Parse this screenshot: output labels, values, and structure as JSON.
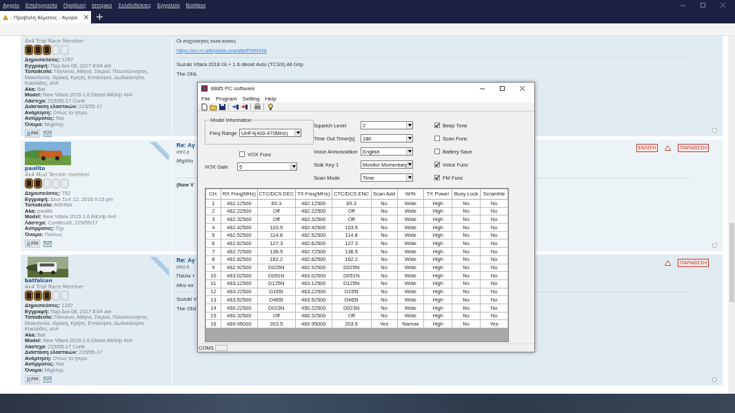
{
  "browser": {
    "menu": [
      "Αρχείο",
      "Επεξεργασία",
      "Προβολή",
      "Ιστορικό",
      "Σελιδοδείκτες",
      "Εργαλεία",
      "Βοήθεια"
    ],
    "tab": {
      "title": "- Προβολή θέματος - Αγορα",
      "selected": true
    }
  },
  "posts": [
    {
      "rank": "4x4 Trial Race Member",
      "stars": 3,
      "stats": [
        "**Δημοσιεύσεις:** 1257",
        "**Εγγραφή:** Παρ Δεκ 08, 2017 8:04 am",
        "**Τοποθεσία:** Γιάννενα, Αθήνα, Στερεά, Πελοπόννησος, Μακεδονία, Θράκη, Κρήτη, Επτάνησα, Δωδεκάνησα, Κυκλάδες, κλπ",
        "**Aka:** Bat",
        "**Model:** New Vitara 2015 1.6 Diesel AllGrip 4x4",
        "**Λάστιχα:** 215/55-17 Conti",
        "**Διάσταση ελαστικών:** 215/55-17",
        "**Ανάρτηση:** Οπως το ηπρο.",
        "**Ασύρματος:** Ναι",
        "**Όνομα:** Μιχάλης"
      ],
      "pm": "PM",
      "lines": [
        {
          "kind": "text",
          "text": "Οι συχνοτητες ειναι κοινες"
        },
        {
          "kind": "link",
          "text": "https://en.m.wikipedia.org/wiki/PMR446"
        },
        {
          "kind": "rule"
        },
        {
          "kind": "text",
          "text": "Suzuki Vitara 2018 GL+ 1.6 diesel Auto (TCSS) All Grip."
        },
        {
          "kind": "text",
          "text": "The ONL"
        }
      ]
    },
    {
      "author": "paolito",
      "online": true,
      "rank": "4x4 Mud Terrain member",
      "stars": 2,
      "stats": [
        "**Δημοσιεύσεις:** 752",
        "**Εγγραφή:** Δευτ Σεπ 12, 2016 9:15 pm",
        "**Τοποθεσία:** ΑΘΗΝΑ",
        "**Aka:** paolito",
        "**Model:** New Vitara 2015 1.6 AllGrip 4x4",
        "**Λάστιχα:** ContiEco5. 215/55/17",
        "**Ασύρματος:** Όχι",
        "**Όνομα:** Παύλος"
      ],
      "pm": "PM",
      "title": "Re: Αγ",
      "byline": "από p",
      "lines": [
        {
          "kind": "italic",
          "text": "Μιχάλη"
        },
        {
          "kind": "gap"
        },
        {
          "kind": "rule"
        },
        {
          "kind": "bold",
          "text": "(New V"
        }
      ],
      "actions": [
        {
          "kind": "button",
          "text": "ΕΚΛΙΣΗ"
        },
        {
          "kind": "warning"
        },
        {
          "kind": "button",
          "text": "ΠΑΡΑΘΕΣΗ"
        }
      ]
    },
    {
      "author": "batfalcon",
      "online": true,
      "rank": "4x4 Trial Race Member",
      "stars": 3,
      "stats": [
        "**Δημοσιεύσεις:** 1257",
        "**Εγγραφή:** Παρ Δεκ 08, 2017 8:04 am",
        "**Τοποθεσία:** Γιάννενα, Αθήνα, Στερεά, Πελοπόννησος, Μακεδονία, Θράκη, Κρήτη, Επτάνησα, Δωδεκάνησα, Κυκλάδες, κλπ",
        "**Aka:** Bat",
        "**Model:** New Vitara 2015 1.6 Diesel AllGrip 4x4",
        "**Λάστιχα:** 215/55-17 Conti",
        "**Διάσταση ελαστικών:** 215/55-17",
        "**Ανάρτηση:** Οπως το ηπρο.",
        "**Ασύρματος:** Ναι",
        "**Όνομα:** Μιχάλης"
      ],
      "pm": "PM",
      "title": "Re: Αγ",
      "byline": "από b",
      "lines": [
        {
          "kind": "text",
          "text": "Παυλε τ"
        },
        {
          "kind": "italic",
          "text": "Μου κα"
        },
        {
          "kind": "rule"
        },
        {
          "kind": "text",
          "text": "Suzuki V"
        },
        {
          "kind": "text",
          "text": "The ONI"
        }
      ],
      "actions": [
        {
          "kind": "warning"
        },
        {
          "kind": "button",
          "text": "ΠΑΡΑΘΕΣΗ"
        }
      ]
    }
  ],
  "dialog": {
    "title": "8885 PC software",
    "menu": [
      "File",
      "Program",
      "Setting",
      "Help"
    ],
    "toolbar": [
      {
        "kind": "new"
      },
      {
        "kind": "open"
      },
      {
        "kind": "save"
      },
      {
        "kind": "read"
      },
      {
        "kind": "write"
      },
      {
        "kind": "print"
      },
      {
        "kind": "help"
      }
    ],
    "model_information": {
      "legend": "Model Information",
      "label": "Freq Range",
      "value": "UHF4(400-470MHz)"
    },
    "vox_func": {
      "label": "VOX Func",
      "checked": false
    },
    "vox_gain": {
      "label": "VOX Gain",
      "value": "5"
    },
    "selects": [
      {
        "label": "Squelch Level",
        "value": "2"
      },
      {
        "label": "Time Out Timer[s]",
        "value": "180"
      },
      {
        "label": "Voice Annunciation",
        "value": "English"
      },
      {
        "label": "Side Key 1",
        "value": "Monitor Momentary"
      },
      {
        "label": "Scan Mode",
        "value": "Time"
      }
    ],
    "checkboxes": [
      {
        "label": "Beep Tone",
        "checked": true
      },
      {
        "label": "Scan Func",
        "checked": false
      },
      {
        "label": "Battery Save",
        "checked": false
      },
      {
        "label": "Voice Func",
        "checked": true
      },
      {
        "label": "FM Func",
        "checked": true
      }
    ],
    "table": {
      "columns": [
        "CH.",
        "RX Freq(MHz)",
        "CTC/DCS DEC",
        "TX Freq(MHz)",
        "CTC/DCS ENC",
        "Scan Add",
        "W/N",
        "TX Power",
        "Busy Lock",
        "Scramble"
      ],
      "rows": [
        [
          "1",
          "462.12500",
          "69.3",
          "462.12500",
          "69.3",
          "No",
          "Wide",
          "High",
          "No",
          "No"
        ],
        [
          "2",
          "462.22500",
          "Off",
          "462.22500",
          "Off",
          "No",
          "Wide",
          "High",
          "No",
          "No"
        ],
        [
          "3",
          "462.32500",
          "Off",
          "462.32500",
          "Off",
          "No",
          "Wide",
          "High",
          "No",
          "No"
        ],
        [
          "4",
          "462.42500",
          "103.5",
          "462.42500",
          "103.5",
          "No",
          "Wide",
          "High",
          "No",
          "No"
        ],
        [
          "5",
          "462.52500",
          "114.8",
          "462.52500",
          "114.8",
          "No",
          "Wide",
          "High",
          "No",
          "No"
        ],
        [
          "6",
          "462.62500",
          "127.3",
          "462.62500",
          "127.3",
          "No",
          "Wide",
          "High",
          "No",
          "No"
        ],
        [
          "7",
          "462.72500",
          "136.5",
          "462.72500",
          "136.5",
          "No",
          "Wide",
          "High",
          "No",
          "No"
        ],
        [
          "8",
          "462.82500",
          "162.2",
          "462.82500",
          "162.2",
          "No",
          "Wide",
          "High",
          "No",
          "No"
        ],
        [
          "9",
          "462.92500",
          "D025N",
          "462.92500",
          "D025N",
          "No",
          "Wide",
          "High",
          "No",
          "No"
        ],
        [
          "10",
          "463.02500",
          "D051N",
          "463.02500",
          "D051N",
          "No",
          "Wide",
          "High",
          "No",
          "No"
        ],
        [
          "11",
          "463.12500",
          "D125N",
          "463.12500",
          "D125N",
          "No",
          "Wide",
          "High",
          "No",
          "No"
        ],
        [
          "12",
          "463.22500",
          "D155I",
          "463.22500",
          "D155I",
          "No",
          "Wide",
          "High",
          "No",
          "No"
        ],
        [
          "13",
          "463.52500",
          "D465I",
          "463.52500",
          "D465I",
          "No",
          "Wide",
          "High",
          "No",
          "No"
        ],
        [
          "14",
          "450.22500",
          "D023N",
          "450.22500",
          "D023N",
          "No",
          "Wide",
          "High",
          "No",
          "No"
        ],
        [
          "15",
          "460.32500",
          "Off",
          "460.32500",
          "Off",
          "No",
          "Wide",
          "High",
          "No",
          "No"
        ],
        [
          "16",
          "469.95000",
          "203.5",
          "469.95000",
          "203.5",
          "Yes",
          "Narrow",
          "High",
          "No",
          "Yes"
        ]
      ]
    },
    "status": "COM3"
  }
}
